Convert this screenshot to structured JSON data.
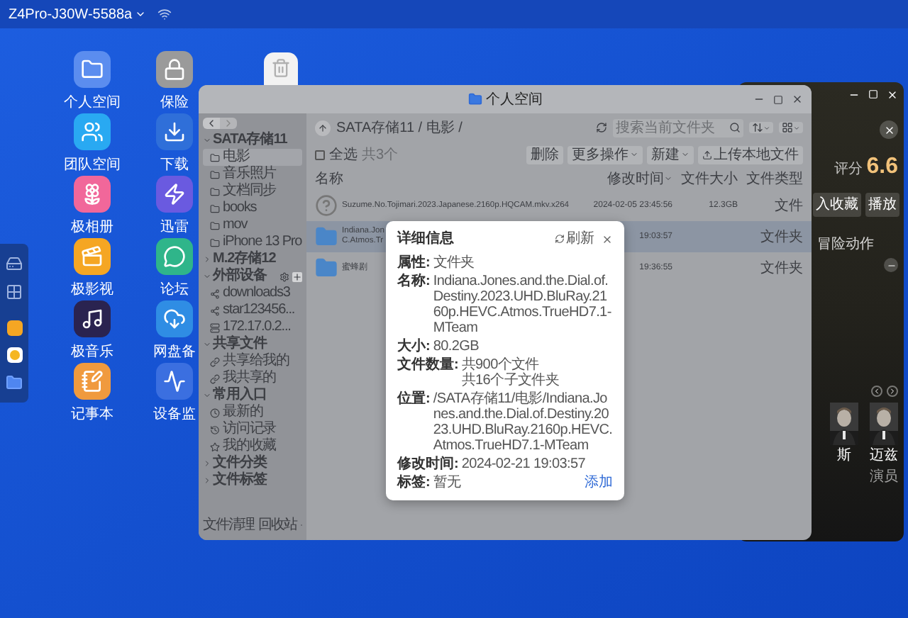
{
  "top_bar": {
    "device": "Z4Pro-J30W-5588a"
  },
  "desktop_icons": [
    {
      "label": "个人空间",
      "kind": "folder"
    },
    {
      "label": "团队空间",
      "kind": "team"
    },
    {
      "label": "极相册",
      "kind": "photos"
    },
    {
      "label": "极影视",
      "kind": "video"
    },
    {
      "label": "极音乐",
      "kind": "music"
    },
    {
      "label": "记事本",
      "kind": "notes"
    },
    {
      "label": "保险",
      "kind": "safe"
    },
    {
      "label": "下载",
      "kind": "download"
    },
    {
      "label": "迅雷",
      "kind": "thunder"
    },
    {
      "label": "论坛",
      "kind": "forum"
    },
    {
      "label": "网盘备",
      "kind": "cloud"
    },
    {
      "label": "设备监",
      "kind": "monitor"
    }
  ],
  "media_window": {
    "rating_label": "评分",
    "rating": "6.6",
    "buttons": [
      "入收藏",
      "播放"
    ],
    "genre": "冒险动作",
    "cast": [
      {
        "name": "斯"
      },
      {
        "name": "迈兹",
        "role": "演员"
      }
    ]
  },
  "file_window": {
    "title": "个人空间",
    "sidebar": [
      {
        "title": "SATA存储11",
        "expanded": true,
        "items": [
          {
            "label": "电影",
            "selected": true,
            "kind": "folder"
          },
          {
            "label": "音乐照片",
            "selected": false,
            "kind": "folder"
          },
          {
            "label": "文档同步",
            "selected": false,
            "kind": "folder"
          },
          {
            "label": "books",
            "selected": false,
            "kind": "folder"
          },
          {
            "label": "mov",
            "selected": false,
            "kind": "folder"
          },
          {
            "label": "iPhone 13 Pro",
            "selected": false,
            "kind": "folder"
          }
        ]
      },
      {
        "title": "M.2存储12",
        "expanded": false
      },
      {
        "title": "外部设备",
        "expanded": true,
        "tools": true,
        "items": [
          {
            "label": "downloads3",
            "selected": false,
            "kind": "share"
          },
          {
            "label": "star123456...",
            "selected": false,
            "kind": "share"
          },
          {
            "label": "172.17.0.2...",
            "selected": false,
            "kind": "server"
          }
        ]
      },
      {
        "title": "共享文件",
        "expanded": true,
        "items": [
          {
            "label": "共享给我的",
            "selected": false,
            "kind": "link"
          },
          {
            "label": "我共享的",
            "selected": false,
            "kind": "link"
          }
        ]
      },
      {
        "title": "常用入口",
        "expanded": true,
        "items": [
          {
            "label": "最新的",
            "selected": false,
            "kind": "recent"
          },
          {
            "label": "访问记录",
            "selected": false,
            "kind": "history"
          },
          {
            "label": "我的收藏",
            "selected": false,
            "kind": "star"
          }
        ]
      },
      {
        "title": "文件分类",
        "expanded": false
      },
      {
        "title": "文件标签",
        "expanded": false
      }
    ],
    "sidebar_footer": [
      "文件清理",
      "回收站"
    ],
    "path": "SATA存储11 / 电影 /",
    "search": {
      "placeholder": "搜索当前文件夹"
    },
    "select_all": {
      "label": "全选",
      "checked": false
    },
    "summary": "共3个",
    "actions": [
      {
        "label": "删除",
        "dropdown": false
      },
      {
        "label": "更多操作",
        "dropdown": true
      },
      {
        "label": "新建",
        "dropdown": true
      },
      {
        "label": "上传本地文件",
        "dropdown": false
      }
    ],
    "columns": [
      {
        "label": "名称",
        "sorted": false
      },
      {
        "label": "修改时间",
        "sorted": true
      },
      {
        "label": "文件大小",
        "sorted": false
      },
      {
        "label": "文件类型",
        "sorted": false
      }
    ],
    "rows": [
      {
        "kind": "unknown",
        "name_lines": [
          "Suzume.No.Tojimari.2023.Japanese.2160p.HQCAM.mkv.x264"
        ],
        "modified": "2024-02-05 23:45:56",
        "size": "12.3GB",
        "type": "文件",
        "selected": false
      },
      {
        "kind": "folder",
        "name_lines": [
          "Indiana.Jon",
          "C.Atmos.Tr"
        ],
        "modified": "19:03:57",
        "type": "文件夹",
        "selected": true
      },
      {
        "kind": "folder",
        "name_lines": [
          "蜜蜂剧"
        ],
        "modified": "19:36:55",
        "type": "文件夹",
        "selected": false
      }
    ]
  },
  "dialog": {
    "title": "详细信息",
    "refresh": "刷新",
    "fields": [
      {
        "label": "属性:",
        "values": [
          "文件夹"
        ]
      },
      {
        "label": "名称:",
        "values": [
          "Indiana.Jones.and.the.Dial.of.Destiny.2023.UHD.BluRay.2160p.HEVC.Atmos.TrueHD7.1-MTeam"
        ]
      },
      {
        "label": "大小:",
        "values": [
          "80.2GB"
        ]
      },
      {
        "label": "文件数量:",
        "values": [
          "共900个文件",
          "共16个子文件夹"
        ]
      },
      {
        "label": "位置:",
        "values": [
          "/SATA存储11/电影/Indiana.Jones.and.the.Dial.of.Destiny.2023.UHD.BluRay.2160p.HEVC.Atmos.TrueHD7.1-MTeam"
        ]
      },
      {
        "label": "修改时间:",
        "values": [
          "2024-02-21 19:03:57"
        ]
      },
      {
        "label": "标签:",
        "values": [
          "暂无"
        ],
        "action": "添加"
      }
    ]
  }
}
